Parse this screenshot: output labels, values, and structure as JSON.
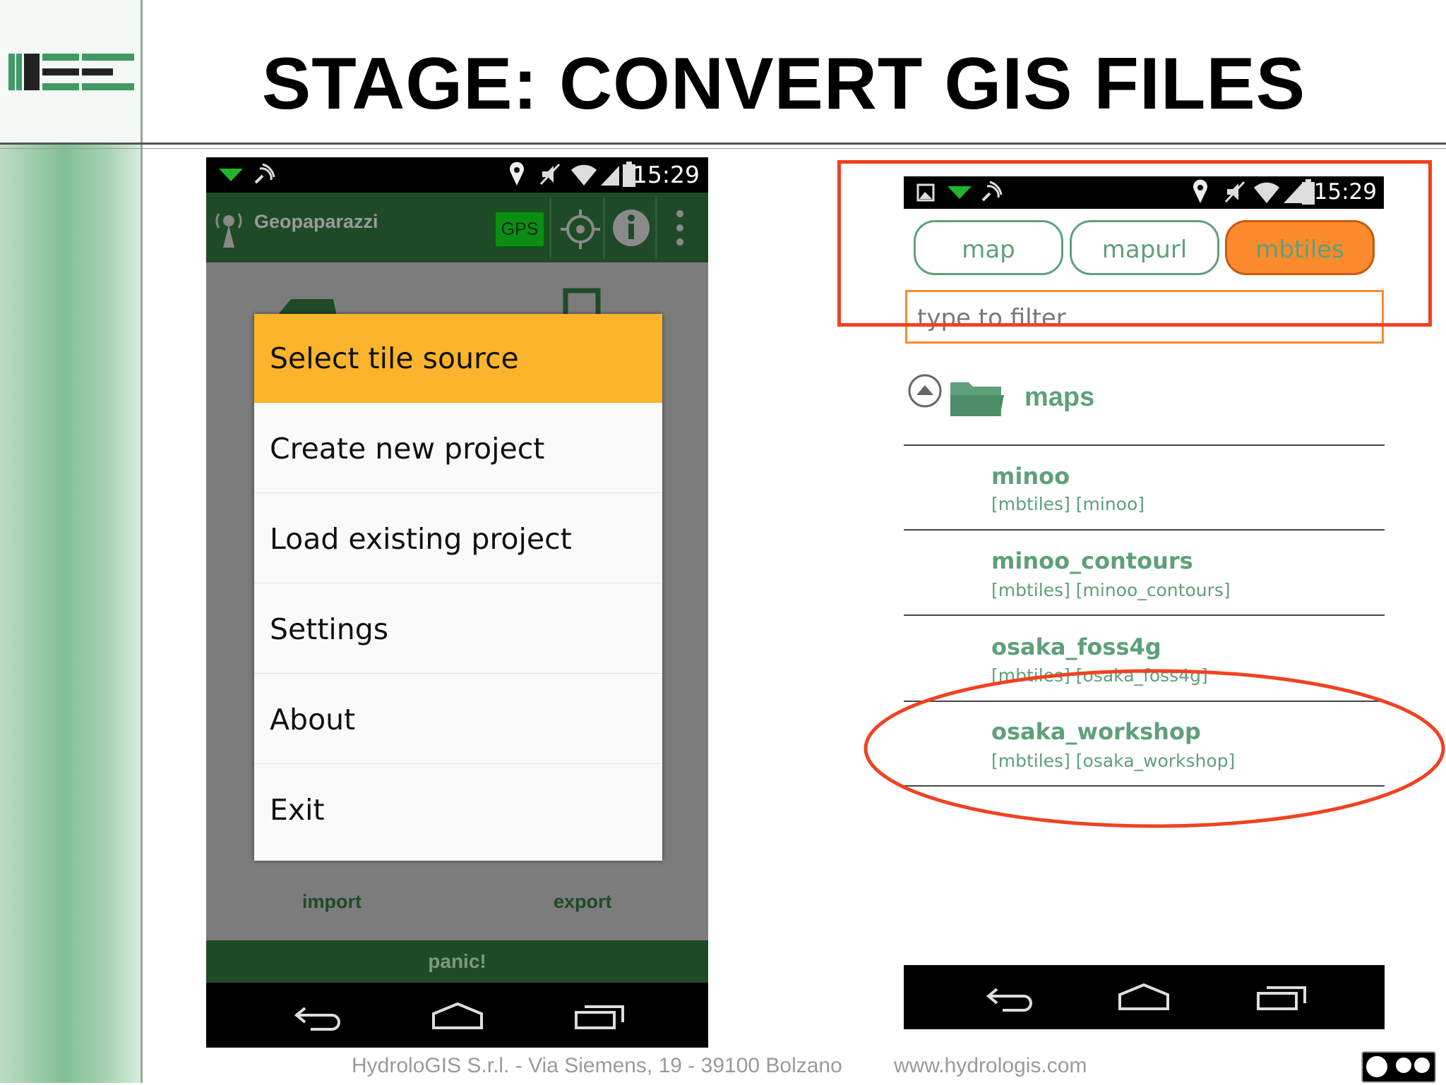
{
  "slide": {
    "title": "STAGE: CONVERT GIS FILES",
    "footer_address": "HydroloGIS S.r.l. - Via Siemens, 19 - 39100 Bolzano",
    "footer_url": "www.hydrologis.com"
  },
  "left_phone": {
    "status_time": "15:29",
    "app_name": "Geopaparazzi",
    "gps_label": "GPS",
    "background_labels": {
      "import": "import",
      "export": "export",
      "panic": "panic!"
    },
    "menu": {
      "items": [
        {
          "label": "Select tile source",
          "selected": true
        },
        {
          "label": "Create new project"
        },
        {
          "label": "Load existing project"
        },
        {
          "label": "Settings"
        },
        {
          "label": "About"
        },
        {
          "label": "Exit"
        }
      ]
    }
  },
  "right_phone": {
    "status_time": "15:29",
    "tabs": [
      {
        "label": "map",
        "active": false
      },
      {
        "label": "mapurl",
        "active": false
      },
      {
        "label": "mbtiles",
        "active": true
      }
    ],
    "filter_placeholder": "type to filter",
    "folder": "maps",
    "files": [
      {
        "name": "minoo",
        "meta": "[mbtiles] [minoo]"
      },
      {
        "name": "minoo_contours",
        "meta": "[mbtiles] [minoo_contours]"
      },
      {
        "name": "osaka_foss4g",
        "meta": "[mbtiles] [osaka_foss4g]"
      },
      {
        "name": "osaka_workshop",
        "meta": "[mbtiles] [osaka_workshop]",
        "highlighted": true
      }
    ]
  },
  "colors": {
    "accent_green": "#5ea07a",
    "dark_green": "#1f4a27",
    "selected_orange": "#fbb42b",
    "tab_orange": "#fb8b2c",
    "annotation_red": "#f04222"
  }
}
